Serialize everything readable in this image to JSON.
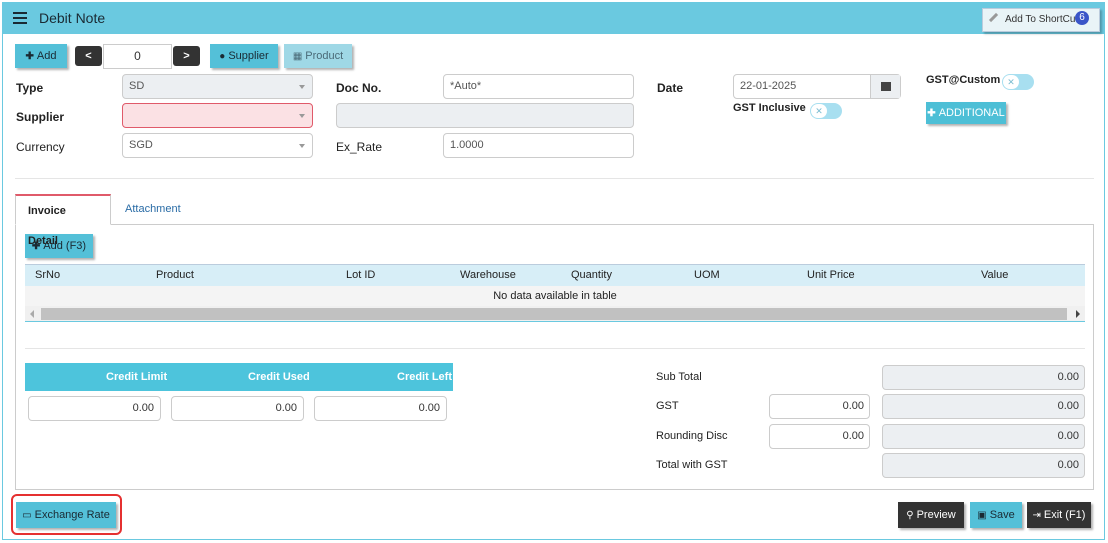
{
  "header": {
    "title": "Debit Note",
    "shortcut_label": "Add To ShortCut",
    "shortcut_badge": "6"
  },
  "toolbar": {
    "add_label": "Add",
    "prev_label": "<",
    "next_label": ">",
    "record_index": "0",
    "supplier_label": "Supplier",
    "product_label": "Product"
  },
  "form": {
    "type_label": "Type",
    "type_value": "SD",
    "supplier_label": "Supplier",
    "supplier_value": "",
    "currency_label": "Currency",
    "currency_value": "SGD",
    "docno_label": "Doc No.",
    "docno_value": "*Auto*",
    "docname_value": "",
    "exrate_label": "Ex_Rate",
    "exrate_value": "1.0000",
    "date_label": "Date",
    "date_value": "22-01-2025",
    "gst_inclusive_label": "GST Inclusive",
    "gst_custom_label": "GST@Custom",
    "additional_label": "ADDITIONAL"
  },
  "tabs": [
    {
      "label": "Invoice Detail"
    },
    {
      "label": "Attachment"
    }
  ],
  "grid": {
    "add_label": "Add (F3)",
    "columns": [
      "SrNo",
      "Product",
      "Lot ID",
      "Warehouse",
      "Quantity",
      "UOM",
      "Unit Price",
      "Value"
    ],
    "empty_text": "No data available in table"
  },
  "credit": {
    "headers": [
      "Credit Limit",
      "Credit Used",
      "Credit Left"
    ],
    "values": [
      "0.00",
      "0.00",
      "0.00"
    ]
  },
  "summary": {
    "subtotal_label": "Sub Total",
    "subtotal_value": "0.00",
    "gst_label": "GST",
    "gst_input": "0.00",
    "gst_value": "0.00",
    "rounding_label": "Rounding Disc",
    "rounding_input": "0.00",
    "rounding_value": "0.00",
    "total_label": "Total with GST",
    "total_value": "0.00"
  },
  "footer": {
    "exchange_label": "Exchange Rate",
    "preview_label": "Preview",
    "save_label": "Save",
    "exit_label": "Exit (F1)"
  },
  "colors": {
    "accent": "#6ac9e0",
    "button": "#54c0d8",
    "error": "#e05a6a",
    "dark": "#333333"
  }
}
